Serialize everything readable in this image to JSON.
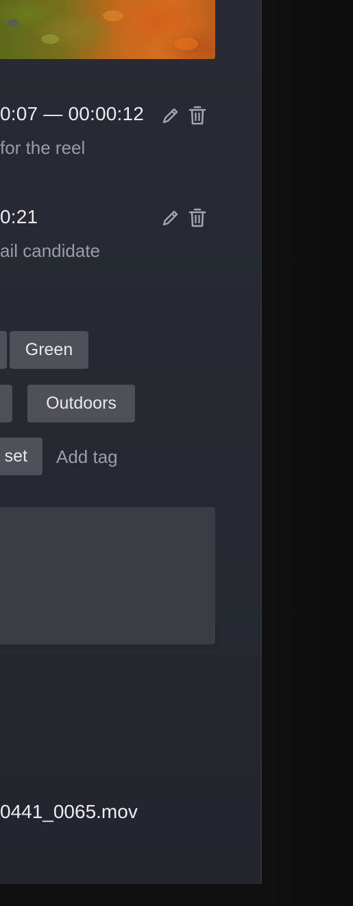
{
  "bookmarks": [
    {
      "time_range": "0:07 — 00:00:12",
      "note": "for the reel",
      "edit_icon": "pencil-icon",
      "delete_icon": "trash-icon"
    },
    {
      "time_range": "0:21",
      "note": "ail candidate",
      "edit_icon": "pencil-icon",
      "delete_icon": "trash-icon"
    }
  ],
  "tags": {
    "items": [
      "Green",
      "Outdoors",
      "set"
    ],
    "add_placeholder": "Add tag"
  },
  "notes": {
    "value": ""
  },
  "file": {
    "name": "0441_0065.mov"
  },
  "colors": {
    "panel": "#282b33",
    "tag_bg": "#4d5056",
    "notes_bg": "#3a3d44",
    "text_primary": "#e9ebef",
    "text_secondary": "#9a9da4",
    "background": "#121212"
  }
}
